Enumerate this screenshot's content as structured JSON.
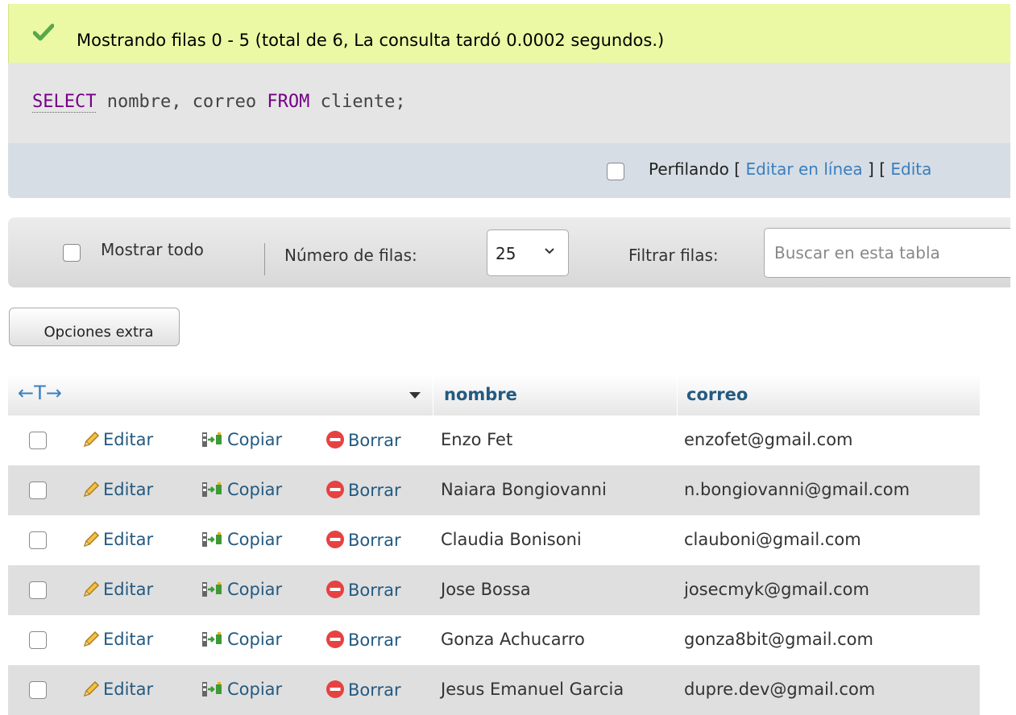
{
  "message": {
    "text": "Mostrando filas 0 - 5 (total de 6, La consulta tardó 0.0002 segundos.)",
    "icon": "check-icon",
    "color": "#ebf8a4"
  },
  "sql": {
    "kw_select": "SELECT",
    "part1": " nombre, correo ",
    "kw_from": "FROM",
    "part2": " cliente;"
  },
  "profiling": {
    "label": "Perfilando",
    "bracket_open": " [ ",
    "edit_inline": "Editar en línea",
    "bracket_mid": " ] [ ",
    "edit_truncated": "Edita"
  },
  "nav": {
    "show_all": "Mostrar todo",
    "rows_label": "Número de filas:",
    "rows_value": "25",
    "filter_label": "Filtrar filas:",
    "search_placeholder": "Buscar en esta tabla"
  },
  "extra_button": "Opciones extra",
  "table": {
    "arrows": "←T→",
    "columns": [
      "nombre",
      "correo"
    ],
    "actions": {
      "edit": "Editar",
      "copy": "Copiar",
      "delete": "Borrar"
    },
    "rows": [
      {
        "nombre": "Enzo Fet",
        "correo": "enzofet@gmail.com"
      },
      {
        "nombre": "Naiara Bongiovanni",
        "correo": "n.bongiovanni@gmail.com"
      },
      {
        "nombre": "Claudia Bonisoni",
        "correo": "clauboni@gmail.com"
      },
      {
        "nombre": "Jose Bossa",
        "correo": "josecmyk@gmail.com"
      },
      {
        "nombre": "Gonza Achucarro",
        "correo": "gonza8bit@gmail.com"
      },
      {
        "nombre": "Jesus Emanuel Garcia",
        "correo": "dupre.dev@gmail.com"
      }
    ]
  },
  "colors": {
    "link": "#235a81",
    "keyword": "#770088",
    "row_alt": "#dfdfdf"
  }
}
